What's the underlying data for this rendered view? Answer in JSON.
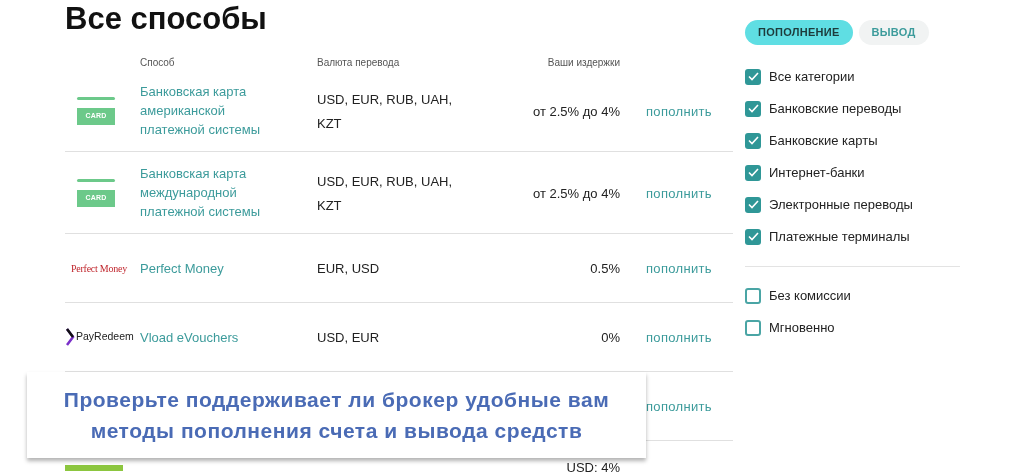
{
  "title": "Все способы",
  "table": {
    "columns": [
      "Способ",
      "Валюта перевода",
      "Ваши издержки"
    ],
    "rows": [
      {
        "kind": "card",
        "logo_text": "CARD",
        "name": "Банковская карта американской платежной системы",
        "currencies": "USD, EUR, RUB, UAH, KZT",
        "cost": "от 2.5% до 4%",
        "action": "пополнить"
      },
      {
        "kind": "card",
        "logo_text": "CARD",
        "name": "Банковская карта международной платежной системы",
        "currencies": "USD, EUR, RUB, UAH, KZT",
        "cost": "от 2.5% до 4%",
        "action": "пополнить"
      },
      {
        "kind": "perfectmoney",
        "logo_text": "Perfect Money",
        "name": "Perfect Money",
        "currencies": "EUR, USD",
        "cost": "0.5%",
        "action": "пополнить"
      },
      {
        "kind": "payredeem",
        "logo_text": "PayRedeem",
        "name": "Vload eVouchers",
        "currencies": "USD, EUR",
        "cost": "0%",
        "action": "пополнить"
      },
      {
        "kind": "hidden",
        "action": "пополнить"
      },
      {
        "kind": "bar",
        "cost": "USD: 4%"
      }
    ]
  },
  "tabs": [
    {
      "label": "ПОПОЛНЕНИЕ",
      "selected": true
    },
    {
      "label": "ВЫВОД",
      "selected": false
    }
  ],
  "categories": [
    {
      "label": "Все категории",
      "checked": true
    },
    {
      "label": "Банковские переводы",
      "checked": true
    },
    {
      "label": "Банковские карты",
      "checked": true
    },
    {
      "label": "Интернет-банки",
      "checked": true
    },
    {
      "label": "Электронные переводы",
      "checked": true
    },
    {
      "label": "Платежные терминалы",
      "checked": true
    }
  ],
  "options": [
    {
      "label": "Без комиссии",
      "checked": false
    },
    {
      "label": "Мгновенно",
      "checked": false
    }
  ],
  "banner": {
    "lines": [
      "Проверьте поддерживает ли брокер удобные вам",
      "методы пополнения счета и вывода средств"
    ]
  }
}
